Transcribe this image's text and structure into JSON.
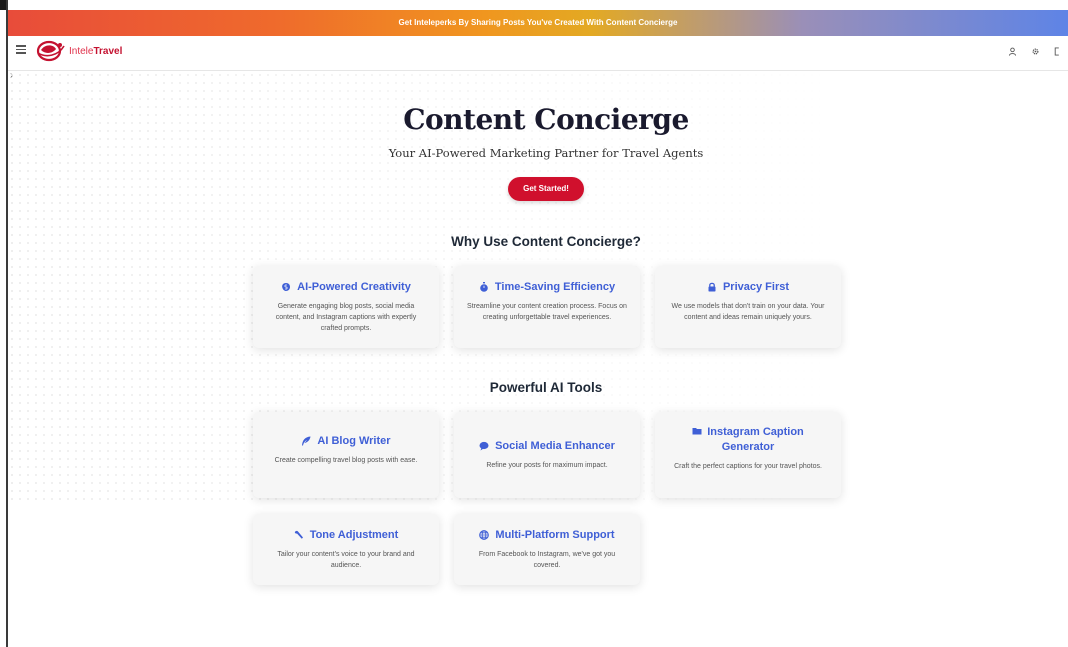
{
  "banner": {
    "text": "Get Inteleperks By Sharing Posts You've Created With Content Concierge"
  },
  "header": {
    "brand_part1": "Intele",
    "brand_part2": "Travel",
    "icons": [
      "user-icon",
      "gear-icon",
      "logout-icon"
    ]
  },
  "hero": {
    "title": "Content Concierge",
    "subtitle": "Your AI-Powered Marketing Partner for Travel Agents",
    "cta_label": "Get Started!"
  },
  "why": {
    "heading": "Why Use Content Concierge?",
    "cards": [
      {
        "icon": "brain-icon",
        "title": "AI-Powered Creativity",
        "desc": "Generate engaging blog posts, social media content, and Instagram captions with expertly crafted prompts."
      },
      {
        "icon": "stopwatch-icon",
        "title": "Time-Saving Efficiency",
        "desc": "Streamline your content creation process. Focus on creating unforgettable travel experiences."
      },
      {
        "icon": "lock-icon",
        "title": "Privacy First",
        "desc": "We use models that don't train on your data. Your content and ideas remain uniquely yours."
      }
    ]
  },
  "tools": {
    "heading": "Powerful AI Tools",
    "cards": [
      {
        "icon": "feather-icon",
        "title": "AI Blog Writer",
        "desc": "Create compelling travel blog posts with ease."
      },
      {
        "icon": "chat-bubble-icon",
        "title": "Social Media Enhancer",
        "desc": "Refine your posts for maximum impact."
      },
      {
        "icon": "folder-icon",
        "title": "Instagram Caption Generator",
        "desc": "Craft the perfect captions for your travel photos."
      },
      {
        "icon": "wrench-icon",
        "title": "Tone Adjustment",
        "desc": "Tailor your content's voice to your brand and audience."
      },
      {
        "icon": "globe-icon",
        "title": "Multi-Platform Support",
        "desc": "From Facebook to Instagram, we've got you covered."
      }
    ]
  },
  "colors": {
    "accent": "#3f5fd6",
    "cta": "#d0102d",
    "brand": "#c41230"
  }
}
